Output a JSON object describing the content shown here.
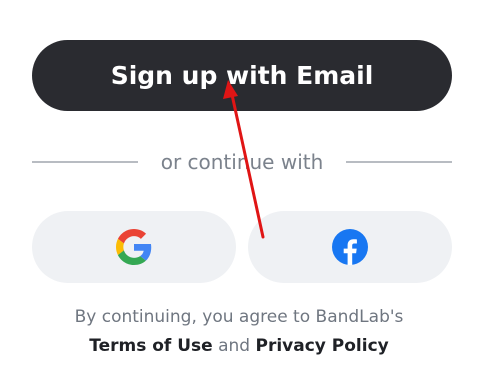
{
  "signup": {
    "email_button_label": "Sign up with Email"
  },
  "divider": {
    "text": "or continue with"
  },
  "social": {
    "google_icon": "google-logo-icon",
    "facebook_icon": "facebook-logo-icon"
  },
  "legal": {
    "prefix": "By continuing, you agree to BandLab's",
    "terms_label": "Terms of Use",
    "conjunction": "and",
    "privacy_label": "Privacy Policy"
  },
  "colors": {
    "primary_button": "#2a2b30",
    "social_button_bg": "#eff1f4",
    "facebook_blue": "#1877f2",
    "annotation_arrow": "#e01515"
  }
}
